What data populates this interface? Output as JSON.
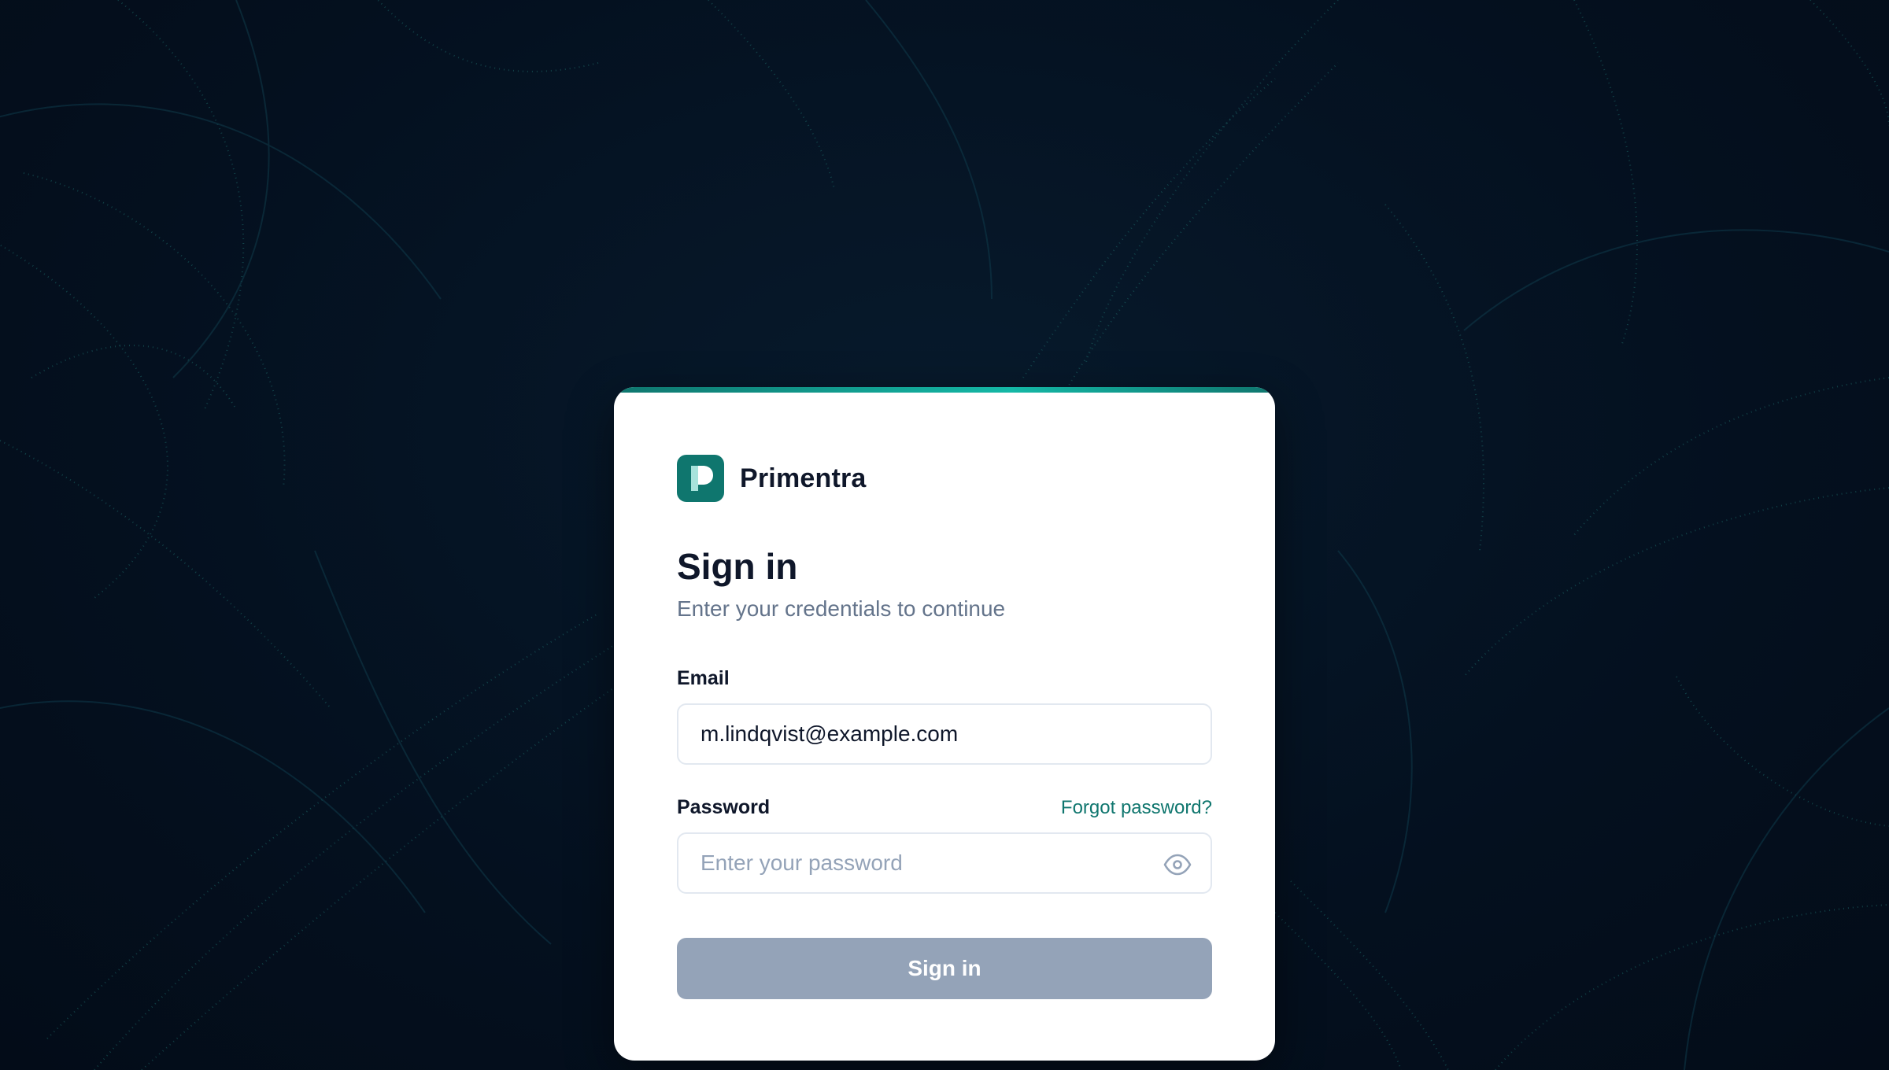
{
  "app": {
    "brand_name": "Primentra",
    "logo_letter": "P"
  },
  "form": {
    "title": "Sign in",
    "subtitle": "Enter your credentials to continue",
    "email": {
      "label": "Email",
      "value": "m.lindqvist@example.com"
    },
    "password": {
      "label": "Password",
      "placeholder": "Enter your password",
      "forgot_label": "Forgot password?"
    },
    "submit_label": "Sign in"
  },
  "icons": {
    "logo": "primentra-logo-icon",
    "reveal_password": "eye-icon"
  },
  "colors": {
    "background": "#04101f",
    "accent": "#0f766e",
    "accent_light": "#14b8a6",
    "button_disabled": "#94a3b8",
    "text_primary": "#0f172a",
    "text_secondary": "#64748b"
  }
}
